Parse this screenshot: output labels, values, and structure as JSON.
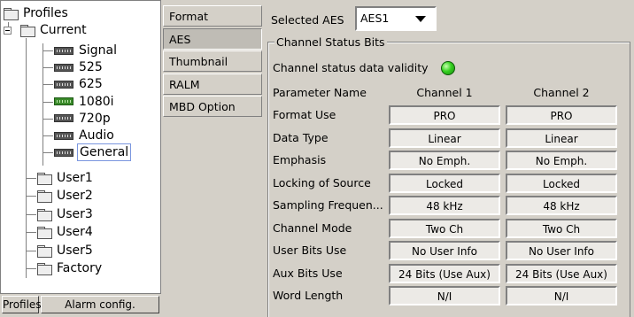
{
  "tree": {
    "root": "Profiles",
    "current": "Current",
    "cards": [
      {
        "label": "Signal",
        "icon": "card-icon"
      },
      {
        "label": "525",
        "icon": "card-icon"
      },
      {
        "label": "625",
        "icon": "card-icon"
      },
      {
        "label": "1080i",
        "icon": "card-green-icon"
      },
      {
        "label": "720p",
        "icon": "card-icon"
      },
      {
        "label": "Audio",
        "icon": "card-icon"
      },
      {
        "label": "General",
        "icon": "card-icon",
        "selected": true
      }
    ],
    "users": [
      "User1",
      "User2",
      "User3",
      "User4",
      "User5",
      "Factory"
    ]
  },
  "bottom_buttons": {
    "profiles": "Profiles",
    "alarm_config": "Alarm config."
  },
  "tabs": [
    {
      "label": "Format",
      "active": false
    },
    {
      "label": "AES",
      "active": true
    },
    {
      "label": "Thumbnail",
      "active": false
    },
    {
      "label": "RALM",
      "active": false
    },
    {
      "label": "MBD Option",
      "active": false
    }
  ],
  "aes": {
    "selected_label": "Selected AES",
    "selected_value": "AES1",
    "group_title": "Channel Status Bits",
    "validity_label": "Channel status data validity",
    "validity_led_color": "#35d020",
    "param_header": "Parameter Name",
    "ch1_header": "Channel 1",
    "ch2_header": "Channel 2",
    "rows": [
      {
        "name": "Format Use",
        "ch1": "PRO",
        "ch2": "PRO"
      },
      {
        "name": "Data Type",
        "ch1": "Linear",
        "ch2": "Linear"
      },
      {
        "name": "Emphasis",
        "ch1": "No Emph.",
        "ch2": "No Emph."
      },
      {
        "name": "Locking of Source",
        "ch1": "Locked",
        "ch2": "Locked"
      },
      {
        "name": "Sampling Frequen...",
        "ch1": "48 kHz",
        "ch2": "48 kHz"
      },
      {
        "name": "Channel Mode",
        "ch1": "Two Ch",
        "ch2": "Two Ch"
      },
      {
        "name": "User Bits Use",
        "ch1": "No User Info",
        "ch2": "No User Info"
      },
      {
        "name": "Aux Bits Use",
        "ch1": "24 Bits (Use Aux)",
        "ch2": "24 Bits (Use Aux)"
      },
      {
        "name": "Word Length",
        "ch1": "N/I",
        "ch2": "N/I"
      }
    ]
  }
}
